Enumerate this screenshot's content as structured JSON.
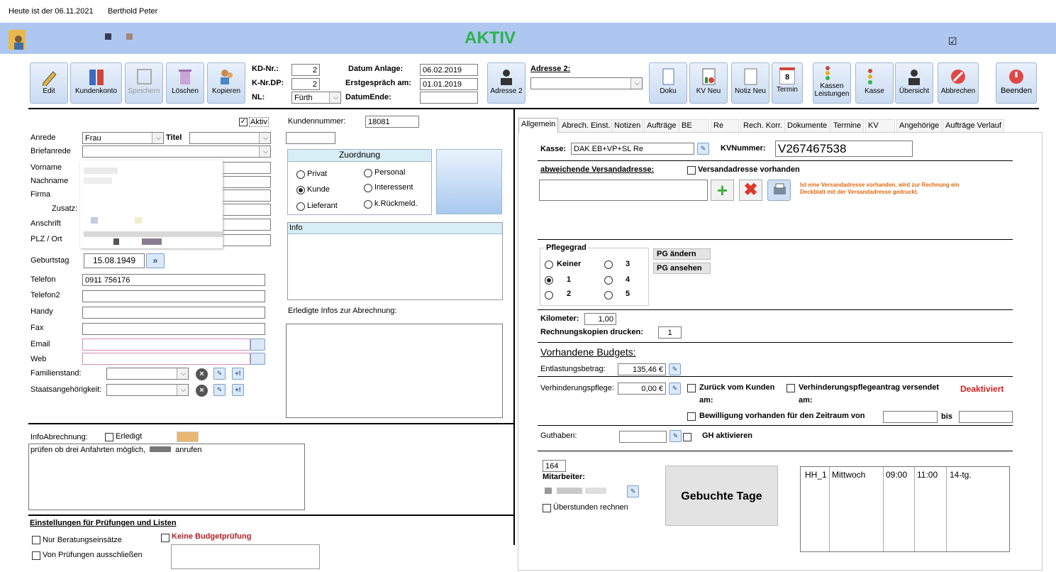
{
  "topbar": {
    "date_text": "Heute ist der 06.11.2021",
    "user": "Berthold Peter"
  },
  "banner": {
    "status": "AKTIV",
    "status_color": "#2db34a",
    "check": "☑"
  },
  "toolbar": {
    "edit": "Edit",
    "kundenkonto": "Kundenkonto",
    "speichern": "Speichern",
    "loeschen": "Löschen",
    "kopieren": "Kopieren",
    "kd_nr_label": "KD-Nr.:",
    "kd_nr": "2",
    "k_nr_dp_label": "K-Nr.DP:",
    "k_nr_dp": "2",
    "nl_label": "NL:",
    "nl": "Fürth",
    "datum_anlage_label": "Datum Anlage:",
    "datum_anlage": "06.02.2019",
    "erstgespraech_label": "Erstgespräch am:",
    "erstgespraech": "01.01.2019",
    "datum_ende_label": "DatumEnde:",
    "datum_ende": "",
    "adresse2_btn": "Adresse 2",
    "adresse2_label": "Adresse 2:",
    "adresse2_value": "",
    "doku": "Doku",
    "kv_neu": "KV Neu",
    "notiz_neu": "Notiz Neu",
    "termin": "Termin",
    "termin_day": "8",
    "kassen_leistungen_1": "Kassen",
    "kassen_leistungen_2": "Leistungen",
    "kasse": "Kasse",
    "uebersicht": "Übersicht",
    "abbrechen": "Abbrechen",
    "beenden": "Beenden"
  },
  "left": {
    "aktiv": "Aktiv",
    "anrede_label": "Anrede",
    "anrede": "Frau",
    "titel_label": "Titel",
    "titel": "",
    "briefanrede_label": "Briefanrede",
    "briefanrede": "",
    "vorname_label": "Vorname",
    "nachname_label": "Nachname",
    "firma_label": "Firma",
    "zusatz_label": "Zusatz:",
    "anschrift_label": "Anschrift",
    "plz_label": "PLZ / Ort",
    "geburtstag_label": "Geburtstag",
    "geburtstag": "15.08.1949",
    "geburtstag_btn": "»",
    "telefon_label": "Telefon",
    "telefon": "0911 756176",
    "telefon2_label": "Telefon2",
    "handy_label": "Handy",
    "fax_label": "Fax",
    "email_label": "Email",
    "web_label": "Web",
    "familienstand_label": "Familienstand:",
    "staats_label": "Staatsangehörigkeit:"
  },
  "mid": {
    "kundennummer_label": "Kundennummer:",
    "kundennummer": "18081",
    "zuordnung_title": "Zuordnung",
    "privat": "Privat",
    "personal": "Personal",
    "kunde": "Kunde",
    "interessent": "Interessent",
    "lieferant": "Lieferant",
    "rueckmeld": "k.Rückmeld.",
    "info_title": "Info",
    "erledigte_label": "Erledigte Infos zur Abrechnung:"
  },
  "infoabr": {
    "label": "InfoAbrechnung:",
    "erledigt": "Erledigt",
    "text_a": "prüfen ob drei Anfahrten möglich,",
    "text_b": "anrufen"
  },
  "einst": {
    "title": "Einstellungen für Prüfungen und Listen",
    "nur_beratung": "Nur Beratungseinsätze",
    "keine_budget": "Keine Budgetprüfung",
    "von_pruef": "Von Prüfungen ausschließen"
  },
  "tabs": [
    "Allgemein",
    "Abrech. Einst.",
    "Notizen",
    "Aufträge",
    "BE",
    "Re",
    "Rech. Korr.",
    "Dokumente",
    "Termine",
    "KV",
    "Angehörige",
    "Aufträge Verlauf"
  ],
  "right": {
    "kasse_label": "Kasse:",
    "kasse": "DAK EB+VP+SL Re",
    "kvnummer_label": "KVNummer:",
    "kvnummer": "V267467538",
    "versand_label": "abweichende Versandadresse:",
    "versand_cb": "Versandadresse vorhanden",
    "versand_hint_1": "Ist eine Versandadresse vorhanden, wird zur Rechnung ein",
    "versand_hint_2": "Deckblatt mit der Versandadresse gedruckt.",
    "pflegegrad_title": "Pflegegrad",
    "keiner": "Keiner",
    "pg1": "1",
    "pg2": "2",
    "pg3": "3",
    "pg4": "4",
    "pg5": "5",
    "pg_aendern": "PG ändern",
    "pg_ansehen": "PG ansehen",
    "km_label": "Kilometer:",
    "km": "1,00",
    "kopien_label": "Rechnungskopien drucken:",
    "kopien": "1",
    "budgets_title": "Vorhandene Budgets:",
    "entlastung_label": "Entlastungsbetrag:",
    "entlastung": "135,46 €",
    "verhinderung_label": "Verhinderungspflege:",
    "verhinderung": "0,00 €",
    "zurueck": "Zurück vom Kunden",
    "am": "am:",
    "antrag": "Verhinderungspflegeantrag versendet",
    "deaktiviert": "Deaktiviert",
    "bewilligung": "Bewilligung vorhanden für den Zeitraum von",
    "bis": "bis",
    "guthaben_label": "Guthaben:",
    "gh_aktivieren": "GH aktivieren",
    "mit_num": "164",
    "mitarbeiter_label": "Mitarbeiter:",
    "ueberstunden": "Überstunden rechnen",
    "gebuchte": "Gebuchte Tage",
    "row": [
      "HH_1",
      "Mittwoch",
      "09:00",
      "11:00",
      "14-tg."
    ]
  }
}
